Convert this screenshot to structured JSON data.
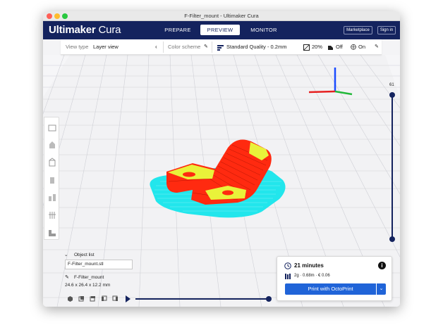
{
  "window": {
    "title": "F-Filter_mount - Ultimaker Cura"
  },
  "header": {
    "logo_part1": "Ultimaker",
    "logo_part2": "Cura",
    "tabs": [
      {
        "label": "PREPARE",
        "active": false
      },
      {
        "label": "PREVIEW",
        "active": true
      },
      {
        "label": "MONITOR",
        "active": false
      }
    ],
    "marketplace_label": "Marketplace",
    "signin_label": "Sign in"
  },
  "toolbar": {
    "view_type_label": "View type",
    "view_type_value": "Layer view",
    "color_scheme_label": "Color scheme",
    "quality_label": "Standard Quality - 0.2mm",
    "infill_value": "20%",
    "support_value": "Off",
    "adhesion_value": "On"
  },
  "layer_slider": {
    "top_value": "61"
  },
  "object_list": {
    "header": "Object list",
    "filename_field": "F-Filter_mount.stl",
    "object_name": "F-Filter_mount",
    "dimensions": "24.6 x 26.4 x 12.2 mm"
  },
  "print_panel": {
    "time": "21 minutes",
    "material": "2g · 0.68m · € 0.06",
    "button_label": "Print with OctoPrint"
  },
  "colors": {
    "header_bg": "#14235e",
    "accent_blue": "#2064d8",
    "model_red": "#ff2a10",
    "model_yellow": "#e9f23a",
    "adhesion_cyan": "#22e6ec"
  }
}
